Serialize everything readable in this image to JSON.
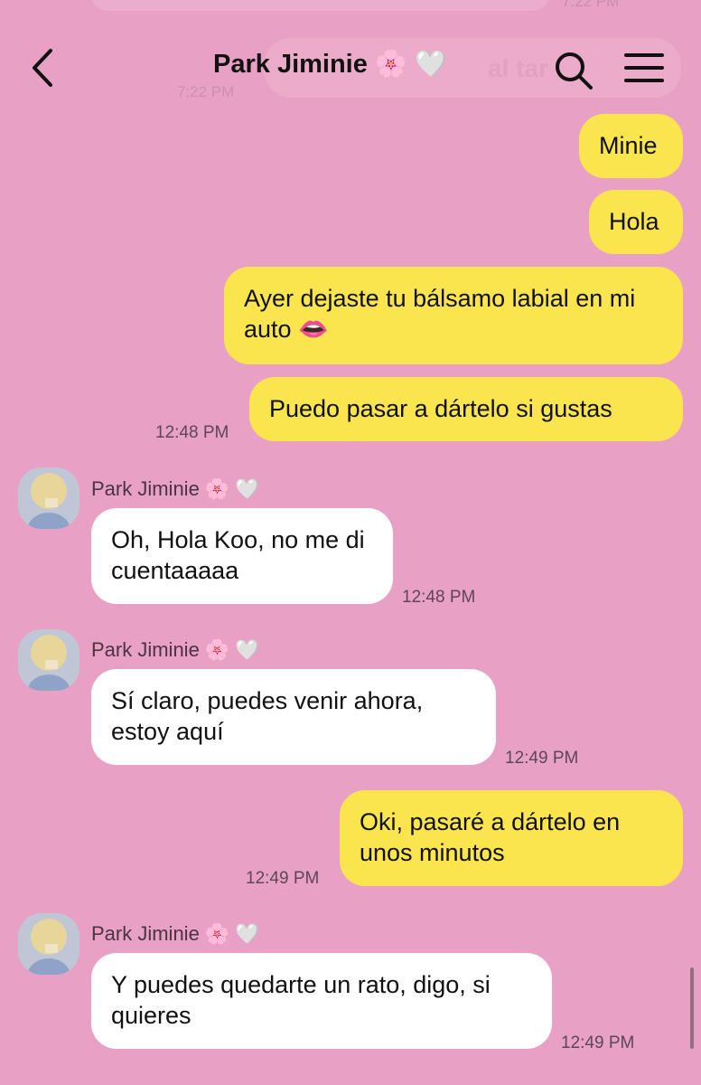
{
  "background": {
    "ghost_time_top": "7:22 PM",
    "ghost_text": "al tar",
    "ghost_time": "7:22 PM"
  },
  "header": {
    "title": "Park Jiminie",
    "title_emoji_1": "🌸",
    "title_emoji_2": "🤍"
  },
  "contact": {
    "name": "Park Jiminie",
    "emoji_1": "🌸",
    "emoji_2": "🤍"
  },
  "colors": {
    "background": "#e8a1c5",
    "outgoing_bubble": "#fae54e",
    "incoming_bubble": "#ffffff"
  },
  "messages": [
    {
      "from": "me",
      "text": "Minie"
    },
    {
      "from": "me",
      "text": "Hola"
    },
    {
      "from": "me",
      "text": "Ayer dejaste tu bálsamo labial en mi auto 👄"
    },
    {
      "from": "me",
      "text": "Puedo pasar a dártelo si gustas",
      "time": "12:48 PM"
    },
    {
      "from": "them",
      "text": "Oh, Hola Koo, no me di cuentaaaaa",
      "time": "12:48 PM"
    },
    {
      "from": "them",
      "text": "Sí claro, puedes venir ahora, estoy aquí",
      "time": "12:49 PM"
    },
    {
      "from": "me",
      "text": "Oki, pasaré a dártelo en unos minutos",
      "time": "12:49 PM"
    },
    {
      "from": "them",
      "text": "Y puedes quedarte un rato, digo, si quieres",
      "time": "12:49 PM"
    }
  ],
  "icons": {
    "back": "back-arrow-icon",
    "search": "search-icon",
    "menu": "hamburger-menu-icon"
  }
}
